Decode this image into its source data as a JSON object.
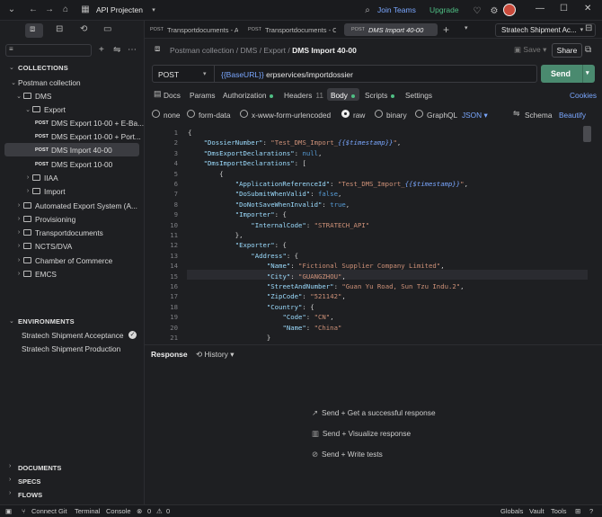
{
  "topbar": {
    "workspace": "API Projecten",
    "join_teams": "Join Teams",
    "upgrade": "Upgrade"
  },
  "sidebar": {
    "collections_header": "COLLECTIONS",
    "tree": [
      {
        "label": "Postman collection",
        "type": "root"
      },
      {
        "label": "DMS",
        "type": "folder"
      },
      {
        "label": "Export",
        "type": "folder"
      },
      {
        "label": "DMS Export 10-00 + E-Ba...",
        "type": "request",
        "method": "POST"
      },
      {
        "label": "DMS Export 10-00 + Port...",
        "type": "request",
        "method": "POST"
      },
      {
        "label": "DMS Import 40-00",
        "type": "request",
        "method": "POST",
        "active": true
      },
      {
        "label": "DMS Export 10-00",
        "type": "request",
        "method": "POST"
      },
      {
        "label": "IIAA",
        "type": "folder"
      },
      {
        "label": "Import",
        "type": "folder"
      },
      {
        "label": "Automated Export System (A...",
        "type": "folder"
      },
      {
        "label": "Provisioning",
        "type": "folder"
      },
      {
        "label": "Transportdocuments",
        "type": "folder"
      },
      {
        "label": "NCTS/DVA",
        "type": "folder"
      },
      {
        "label": "Chamber of Commerce",
        "type": "folder"
      },
      {
        "label": "EMCS",
        "type": "folder"
      }
    ],
    "environments_header": "ENVIRONMENTS",
    "environments": [
      "Stratech Shipment Acceptance",
      "Stratech Shipment Production"
    ],
    "bottom": [
      "DOCUMENTS",
      "SPECS",
      "FLOWS"
    ]
  },
  "tabs": [
    {
      "method": "POST",
      "label": "Transportdocuments - A"
    },
    {
      "method": "POST",
      "label": "Transportdocuments - C"
    },
    {
      "method": "POST",
      "label": "DMS Import 40-00"
    }
  ],
  "env_select": "Stratech Shipment Ac...",
  "breadcrumb": {
    "a": "Postman collection",
    "b": "DMS",
    "c": "Export",
    "current": "DMS Import 40-00"
  },
  "actions": {
    "save": "Save",
    "share": "Share"
  },
  "request": {
    "method": "POST",
    "url_var": "{{BaseURL}}",
    "url_path": " erpservices/importdossier",
    "send": "Send"
  },
  "req_tabs": {
    "docs": "Docs",
    "params": "Params",
    "auth": "Authorization",
    "headers": "Headers",
    "headers_count": "11",
    "body": "Body",
    "scripts": "Scripts",
    "settings": "Settings",
    "cookies": "Cookies"
  },
  "body_opts": {
    "none": "none",
    "form": "form-data",
    "urlenc": "x-www-form-urlencoded",
    "raw": "raw",
    "binary": "binary",
    "graphql": "GraphQL",
    "json": "JSON",
    "schema": "Schema",
    "beautify": "Beautify"
  },
  "code_lines": [
    "{",
    "    \"DossierNumber\": \"Test_DMS_Import_{{$timestamp}}\",",
    "    \"DmsExportDeclarations\": null,",
    "    \"DmsImportDeclarations\": [",
    "        {",
    "            \"ApplicationReferenceId\": \"Test_DMS_Import_{{$timestamp}}\",",
    "            \"DoSubmitWhenValid\": false,",
    "            \"DoNotSaveWhenInvalid\": true,",
    "            \"Importer\": {",
    "                \"InternalCode\": \"STRATECH_API\"",
    "            },",
    "            \"Exporter\": {",
    "                \"Address\": {",
    "                    \"Name\": \"Fictional Supplier Company Limited\",",
    "                    \"City\": \"GUANGZHOU\",",
    "                    \"StreetAndNumber\": \"Guan Yu Road, Sun Tzu Indu.2\",",
    "                    \"ZipCode\": \"521142\",",
    "                    \"Country\": {",
    "                        \"Code\": \"CN\",",
    "                        \"Name\": \"China\"",
    "                    }"
  ],
  "response": {
    "title": "Response",
    "history": "History",
    "hints": [
      "Send + Get a successful response",
      "Send + Visualize response",
      "Send + Write tests"
    ]
  },
  "status": {
    "connect_git": "Connect Git",
    "terminal": "Terminal",
    "console": "Console",
    "errors": "0",
    "warnings": "0",
    "globals": "Globals",
    "vault": "Vault",
    "tools": "Tools"
  }
}
